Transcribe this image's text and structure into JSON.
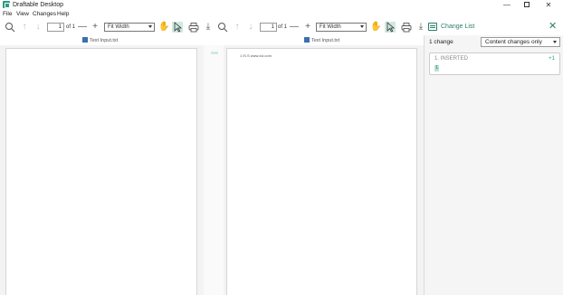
{
  "window": {
    "title": "Draftable Desktop",
    "minimize": "—",
    "close": "✕"
  },
  "menu": [
    "File",
    "View",
    "Changes",
    "Help"
  ],
  "left_pane": {
    "page_number": "1",
    "page_of": "of 1",
    "zoom": "Fit Width",
    "file_name": "Text Input.txt",
    "content": ""
  },
  "right_pane": {
    "page_number": "1",
    "page_of": "of 1",
    "zoom": "Fit Width",
    "file_name": "Text Input.txt",
    "content": "1 iS.S www.xcl.com"
  },
  "change_panel": {
    "title": "Change List",
    "close": "✕",
    "count_label": "1 change",
    "filter": "Content changes only",
    "changes": [
      {
        "type": "1. INSERTED",
        "delta": "+1",
        "value": "1"
      }
    ]
  },
  "icons": {
    "zoom_out": "search-icon",
    "prev_page": "arrow-up-icon",
    "next_page": "arrow-down-icon",
    "zoom_out_minus": "minus-icon",
    "zoom_in_plus": "plus-icon",
    "pan": "hand-icon",
    "select": "pointer-icon",
    "print": "printer-icon",
    "download": "download-icon"
  },
  "colors": {
    "accent": "#2a7d6a",
    "highlight": "#b9e3d5",
    "active_tool": "#cfe9e1"
  }
}
